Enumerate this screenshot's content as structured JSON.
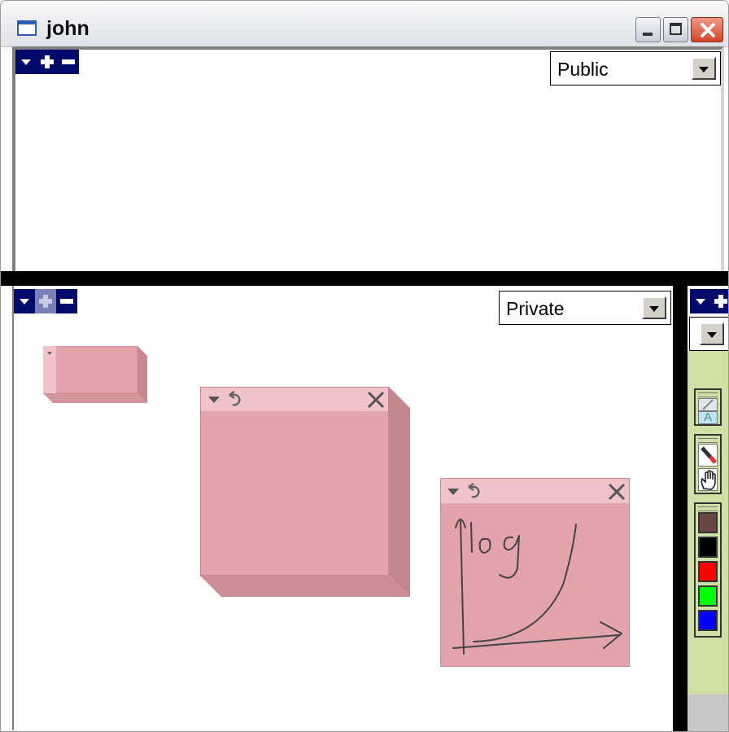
{
  "window": {
    "title": "john",
    "controls": [
      "minimize-icon",
      "maximize-icon",
      "close-icon"
    ]
  },
  "public_pane": {
    "visibility_select": {
      "value": "Public"
    },
    "toolbar": [
      "menu-arrow-icon",
      "plus-icon",
      "minus-icon"
    ]
  },
  "private_pane": {
    "visibility_select": {
      "value": "Private"
    },
    "toolbar": [
      "menu-arrow-icon",
      "plus-icon",
      "minus-icon"
    ]
  },
  "notes": [
    {
      "id": "note-small",
      "state": "collapsed"
    },
    {
      "id": "note-blank",
      "icons": [
        "menu-arrow-icon",
        "undo-icon",
        "close-icon"
      ]
    },
    {
      "id": "note-sketch",
      "icons": [
        "menu-arrow-icon",
        "undo-icon",
        "close-icon"
      ],
      "handwriting": "log"
    }
  ],
  "tool_palette": {
    "tools": [
      "pen-icon",
      "text-icon",
      "eraser-icon",
      "hand-icon"
    ],
    "text_tool_glyph": "A",
    "colors": [
      "#6b4444",
      "#000000",
      "#ff0000",
      "#00ff00",
      "#0000ff"
    ]
  },
  "colors": {
    "note": "#e3a3ab",
    "note_header": "#efc3c8",
    "palette_bg": "#cfe0a6",
    "toolbar_blue": "#000a6b"
  }
}
